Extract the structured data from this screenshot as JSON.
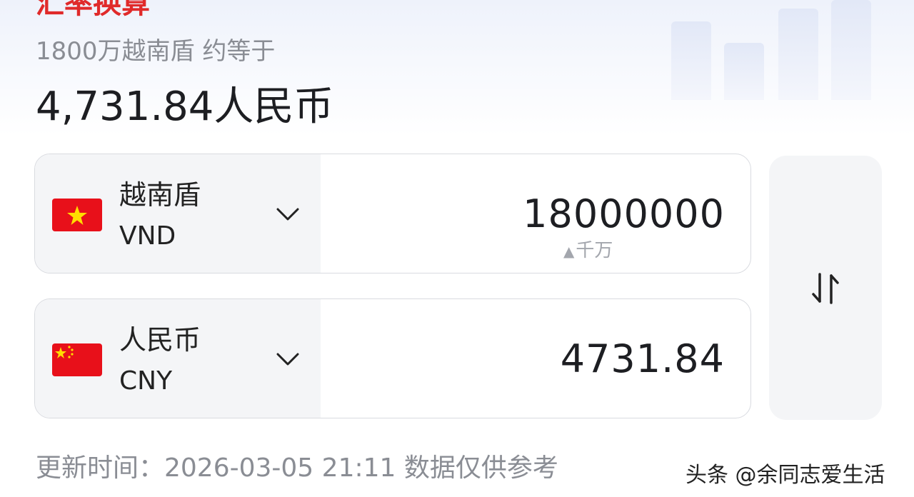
{
  "header": {
    "cut_title": "汇率换算",
    "subtitle": "1800万越南盾 约等于",
    "result": "4,731.84人民币"
  },
  "from_currency": {
    "name": "越南盾",
    "code": "VND",
    "amount": "18000000",
    "magnitude_hint": "千万",
    "flag_icon": "vietnam-flag-icon",
    "flag_colors": {
      "field": "#e8101a",
      "star": "#ffdd00"
    }
  },
  "to_currency": {
    "name": "人民币",
    "code": "CNY",
    "amount": "4731.84",
    "flag_icon": "china-flag-icon",
    "flag_colors": {
      "field": "#e8101a",
      "star": "#ffdd00"
    }
  },
  "swap": {
    "icon": "swap-vertical-icon"
  },
  "footer": {
    "update_text": "更新时间：2026-03-05 21:11 数据仅供参考"
  },
  "watermark": "头条 @余同志爱生活"
}
